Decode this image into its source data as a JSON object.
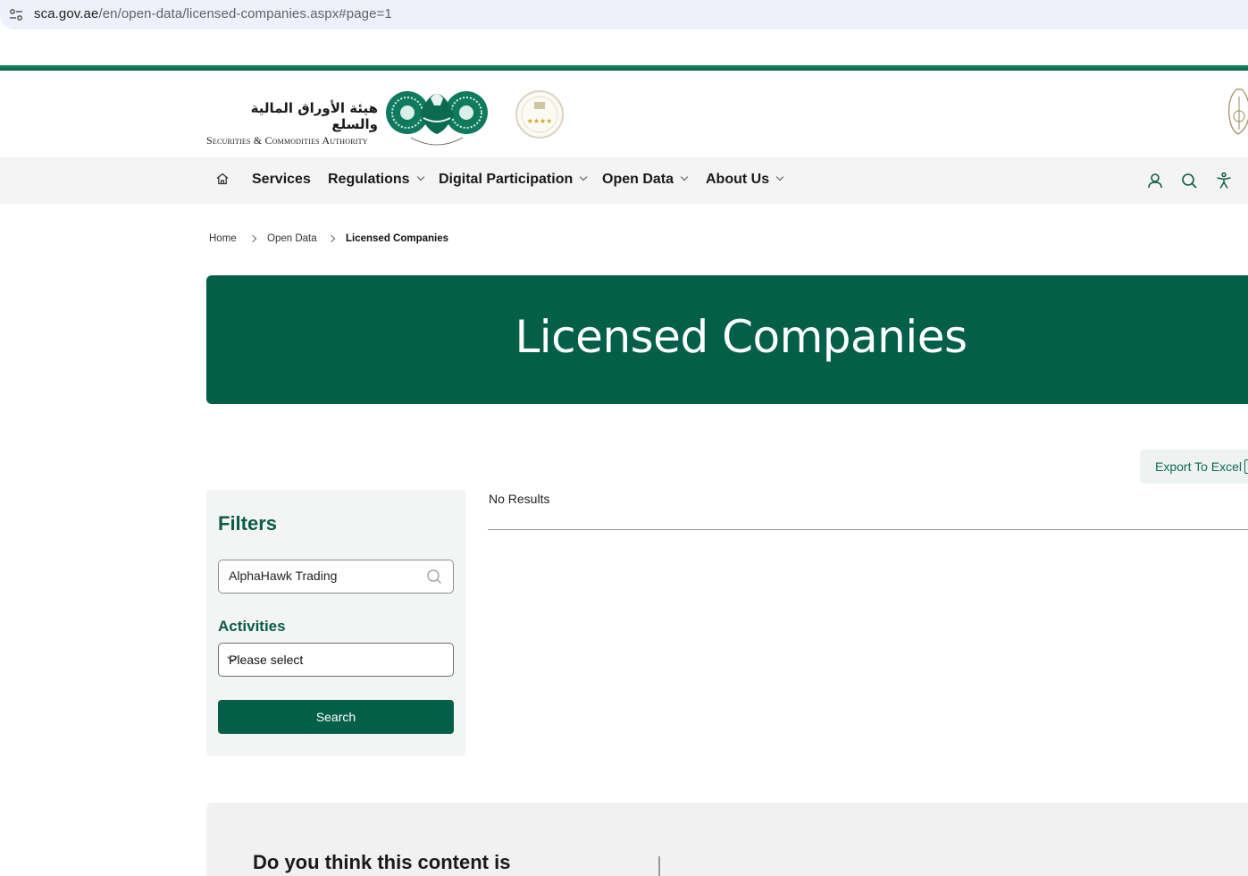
{
  "browser": {
    "url_host": "sca.gov.ae",
    "url_path": "/en/open-data/licensed-companies.aspx#page=1"
  },
  "header": {
    "logo_arabic": "هيئة الأوراق المالية والسلع",
    "logo_english": "Securities & Commodities Authority"
  },
  "nav": {
    "items": [
      {
        "label": "Services",
        "has_dropdown": false
      },
      {
        "label": "Regulations",
        "has_dropdown": true
      },
      {
        "label": "Digital Participation",
        "has_dropdown": true
      },
      {
        "label": "Open Data",
        "has_dropdown": true
      },
      {
        "label": "About Us",
        "has_dropdown": true
      }
    ],
    "icons": [
      "home-icon",
      "user-icon",
      "search-icon",
      "accessibility-icon"
    ]
  },
  "breadcrumb": {
    "items": [
      "Home",
      "Open Data",
      "Licensed Companies"
    ]
  },
  "hero": {
    "title": "Licensed Companies"
  },
  "export": {
    "label": "Export To Excel"
  },
  "filters": {
    "title": "Filters",
    "search_value": "AlphaHawk Trading",
    "activities_label": "Activities",
    "activities_selected": "Please select",
    "search_button": "Search"
  },
  "results": {
    "status": "No Results"
  },
  "feedback": {
    "question": "Do you think this content is"
  },
  "colors": {
    "brand_green": "#045f49",
    "heading_green": "#0a5c46",
    "nav_bg": "#f4f4f4"
  }
}
